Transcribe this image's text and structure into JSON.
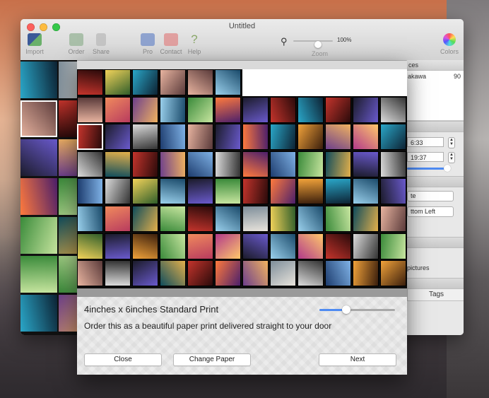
{
  "window": {
    "title": "Untitled",
    "toolbar": [
      {
        "id": "import",
        "label": "Import",
        "icon": "import-icon",
        "color": "#3b5998"
      },
      {
        "id": "order",
        "label": "Order",
        "icon": "order-icon",
        "color": "#7fa07f"
      },
      {
        "id": "share",
        "label": "Share",
        "icon": "share-icon",
        "color": "#9a9a9a"
      },
      {
        "id": "pro",
        "label": "Pro",
        "icon": "pro-icon",
        "color": "#6a7fb2"
      },
      {
        "id": "contact",
        "label": "Contact",
        "icon": "contact-icon",
        "color": "#c24a4a"
      },
      {
        "id": "help",
        "label": "Help",
        "icon": "help-icon",
        "color": "#8aa86a"
      },
      {
        "id": "colors",
        "label": "Colors",
        "icon": "colors-icon",
        "color": "#d87ad8"
      }
    ],
    "zoom": {
      "label": "Zoom",
      "value": "100%",
      "level": 0.3
    }
  },
  "right_panel": {
    "header": "ces",
    "row_name": "akawa",
    "row_value": "90",
    "time1": "6:33",
    "time2": "19:37",
    "select1": "te",
    "select2": "ttom Left",
    "checkbox_label": "pictures",
    "tab": "Tags"
  },
  "dialog": {
    "title": "4inches x 6inches Standard Print",
    "description": "Order this as a beautiful paper print delivered straight to your door",
    "size_slider": 0.3,
    "buttons": {
      "close": "Close",
      "change_paper": "Change Paper",
      "next": "Next"
    }
  },
  "accent": "#4e8bf2"
}
